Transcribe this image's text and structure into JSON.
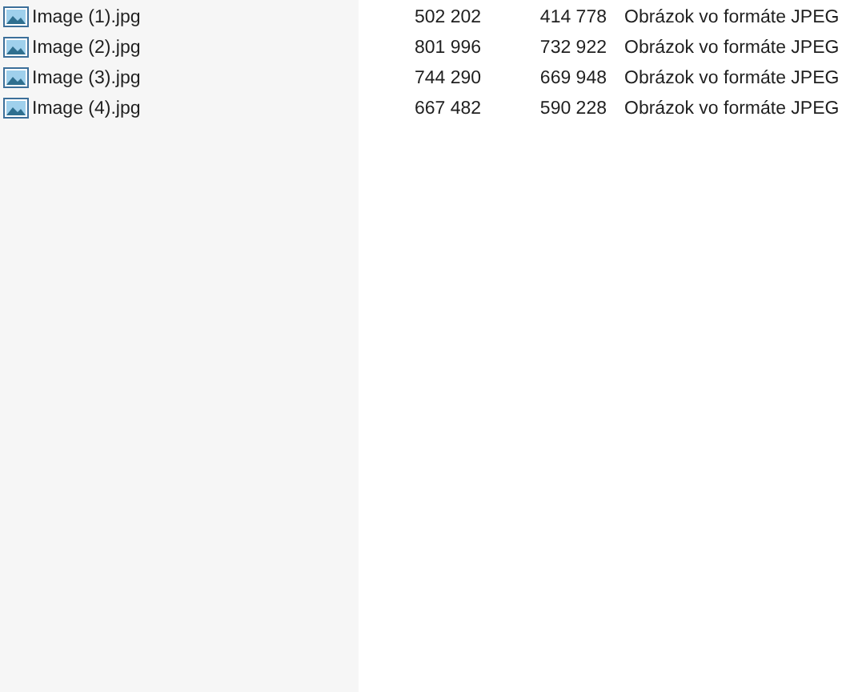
{
  "files": [
    {
      "name": "Image (1).jpg",
      "column_2": "502 202",
      "column_3": "414 778",
      "column_4": "Obrázok vo formáte JPEG"
    },
    {
      "name": "Image (2).jpg",
      "column_2": "801 996",
      "column_3": "732 922",
      "column_4": "Obrázok vo formáte JPEG"
    },
    {
      "name": "Image (3).jpg",
      "column_2": "744 290",
      "column_3": "669 948",
      "column_4": "Obrázok vo formáte JPEG"
    },
    {
      "name": "Image (4).jpg",
      "column_2": "667 482",
      "column_3": "590 228",
      "column_4": "Obrázok vo formáte JPEG"
    }
  ]
}
